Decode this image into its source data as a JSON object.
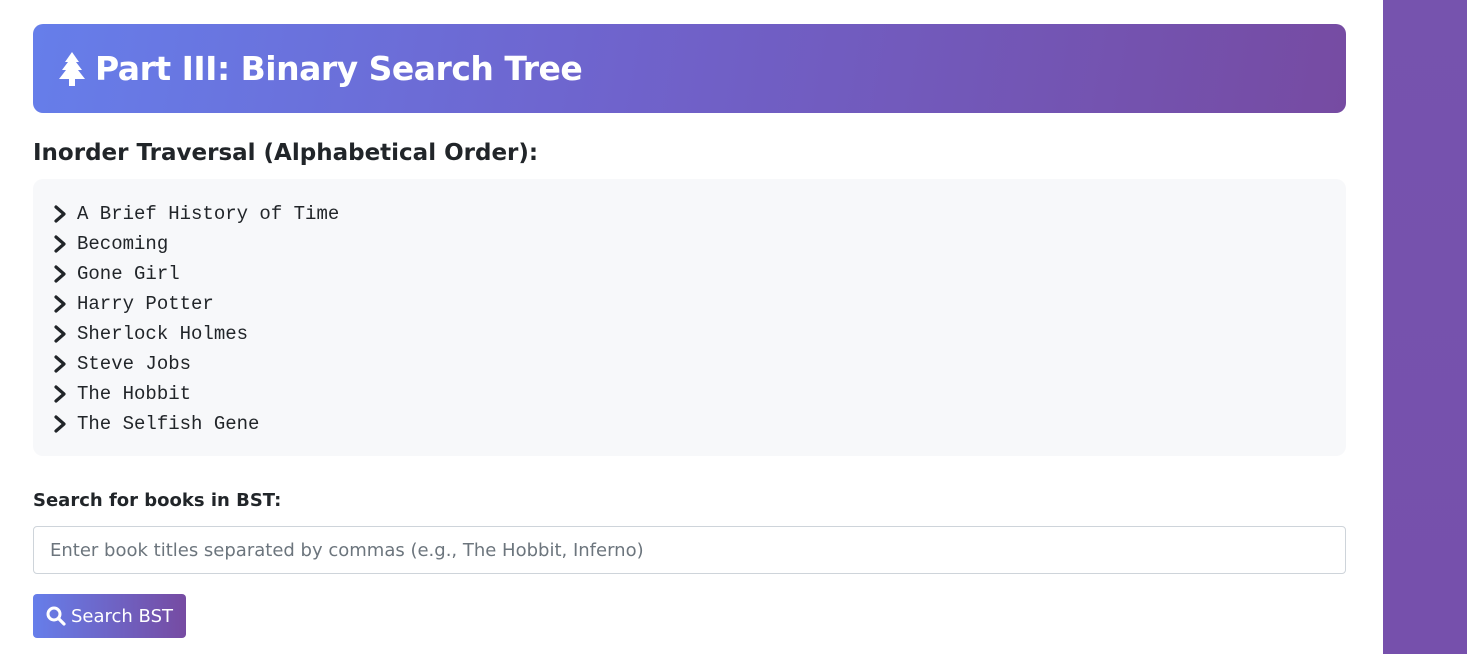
{
  "header": {
    "icon": "tree-icon",
    "title": "Part III: Binary Search Tree"
  },
  "traversal": {
    "heading": "Inorder Traversal (Alphabetical Order):",
    "item_icon": "chevron-right-icon",
    "items": [
      "A Brief History of Time",
      "Becoming",
      "Gone Girl",
      "Harry Potter",
      "Sherlock Holmes",
      "Steve Jobs",
      "The Hobbit",
      "The Selfish Gene"
    ]
  },
  "search": {
    "label": "Search for books in BST:",
    "placeholder": "Enter book titles separated by commas (e.g., The Hobbit, Inferno)",
    "value": "",
    "button_label": "Search BST",
    "button_icon": "search-icon"
  },
  "colors": {
    "gradient_start": "#667eea",
    "gradient_end": "#764ba2",
    "panel_bg": "#f7f8fa",
    "text": "#212529",
    "side_panel": "#7653ae"
  }
}
